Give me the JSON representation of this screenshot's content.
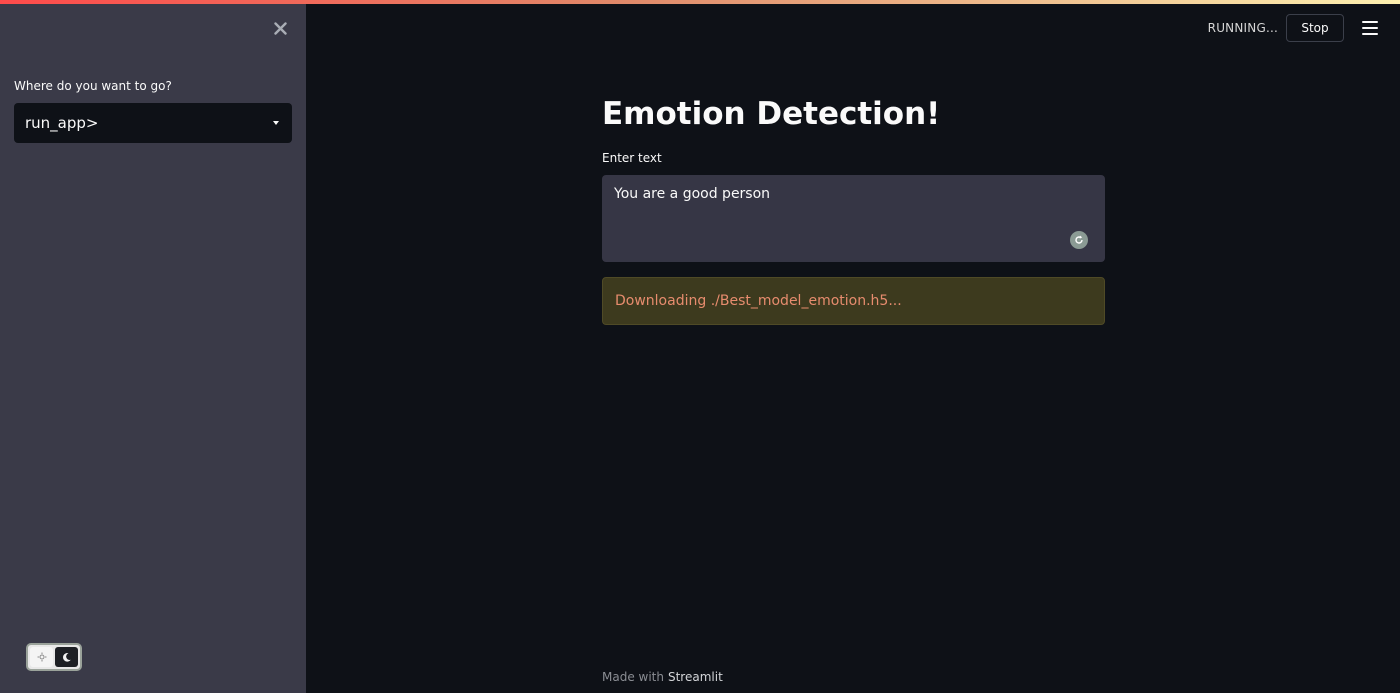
{
  "header": {
    "status": "RUNNING...",
    "stop_label": "Stop"
  },
  "sidebar": {
    "nav_label": "Where do you want to go?",
    "nav_selected": "run_app>"
  },
  "main": {
    "title": "Emotion Detection!",
    "input_label": "Enter text",
    "input_value": "You are a good person",
    "download_message": "Downloading ./Best_model_emotion.h5..."
  },
  "footer": {
    "made_with": "Made with",
    "link": "Streamlit"
  },
  "icons": {
    "close": "close-icon",
    "menu": "hamburger-menu-icon",
    "caret": "caret-down-icon",
    "refresh": "refresh-icon",
    "theme_light": "sun-icon",
    "theme_dark": "moon-icon"
  },
  "colors": {
    "background": "#0e1117",
    "sidebar": "#3a3a48",
    "textarea": "#363645",
    "warning_bg": "#3d3a1e",
    "warning_text": "#e78c6e"
  }
}
